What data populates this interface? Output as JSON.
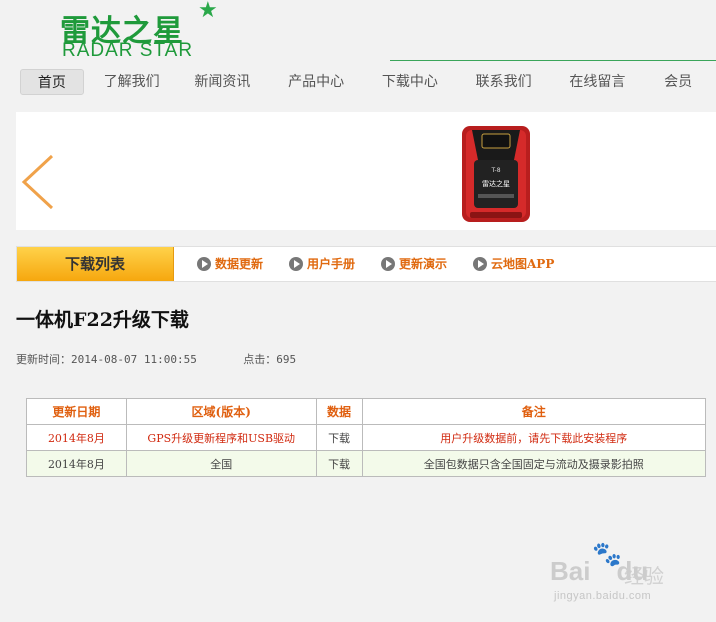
{
  "logo": {
    "cn": "雷达之星",
    "en": "RADAR STAR"
  },
  "nav": {
    "items": [
      "首页",
      "了解我们",
      "新闻资讯",
      "产品中心",
      "下载中心",
      "联系我们",
      "在线留言",
      "会员"
    ],
    "active_index": 0
  },
  "banner": {
    "device_model": "T-8",
    "device_brand": "雷达之星"
  },
  "tabs": {
    "main": "下载列表",
    "links": [
      "数据更新",
      "用户手册",
      "更新演示",
      "云地图APP"
    ]
  },
  "article": {
    "title": "一体机F22升级下载",
    "update_label": "更新时间：",
    "update_time": "2014-08-07 11:00:55",
    "hits_label": "点击：",
    "hits": "695"
  },
  "table": {
    "headers": [
      "更新日期",
      "区域(版本)",
      "数据",
      "备注"
    ],
    "rows": [
      [
        "2014年8月",
        "GPS升级更新程序和USB驱动",
        "下载",
        "用户升级数据前，请先下载此安装程序"
      ],
      [
        "2014年8月",
        "全国",
        "下载",
        "全国包数据只含全国固定与流动及摄录影拍照"
      ]
    ]
  },
  "watermark": {
    "logo": "Bai",
    "logo2": "du",
    "cn": "经验",
    "url": "jingyan.baidu.com"
  },
  "colors": {
    "brand_green": "#1f9a3b",
    "tab_orange": "#f6a70e",
    "link_orange": "#e06a10",
    "alert_red": "#d12a10"
  }
}
